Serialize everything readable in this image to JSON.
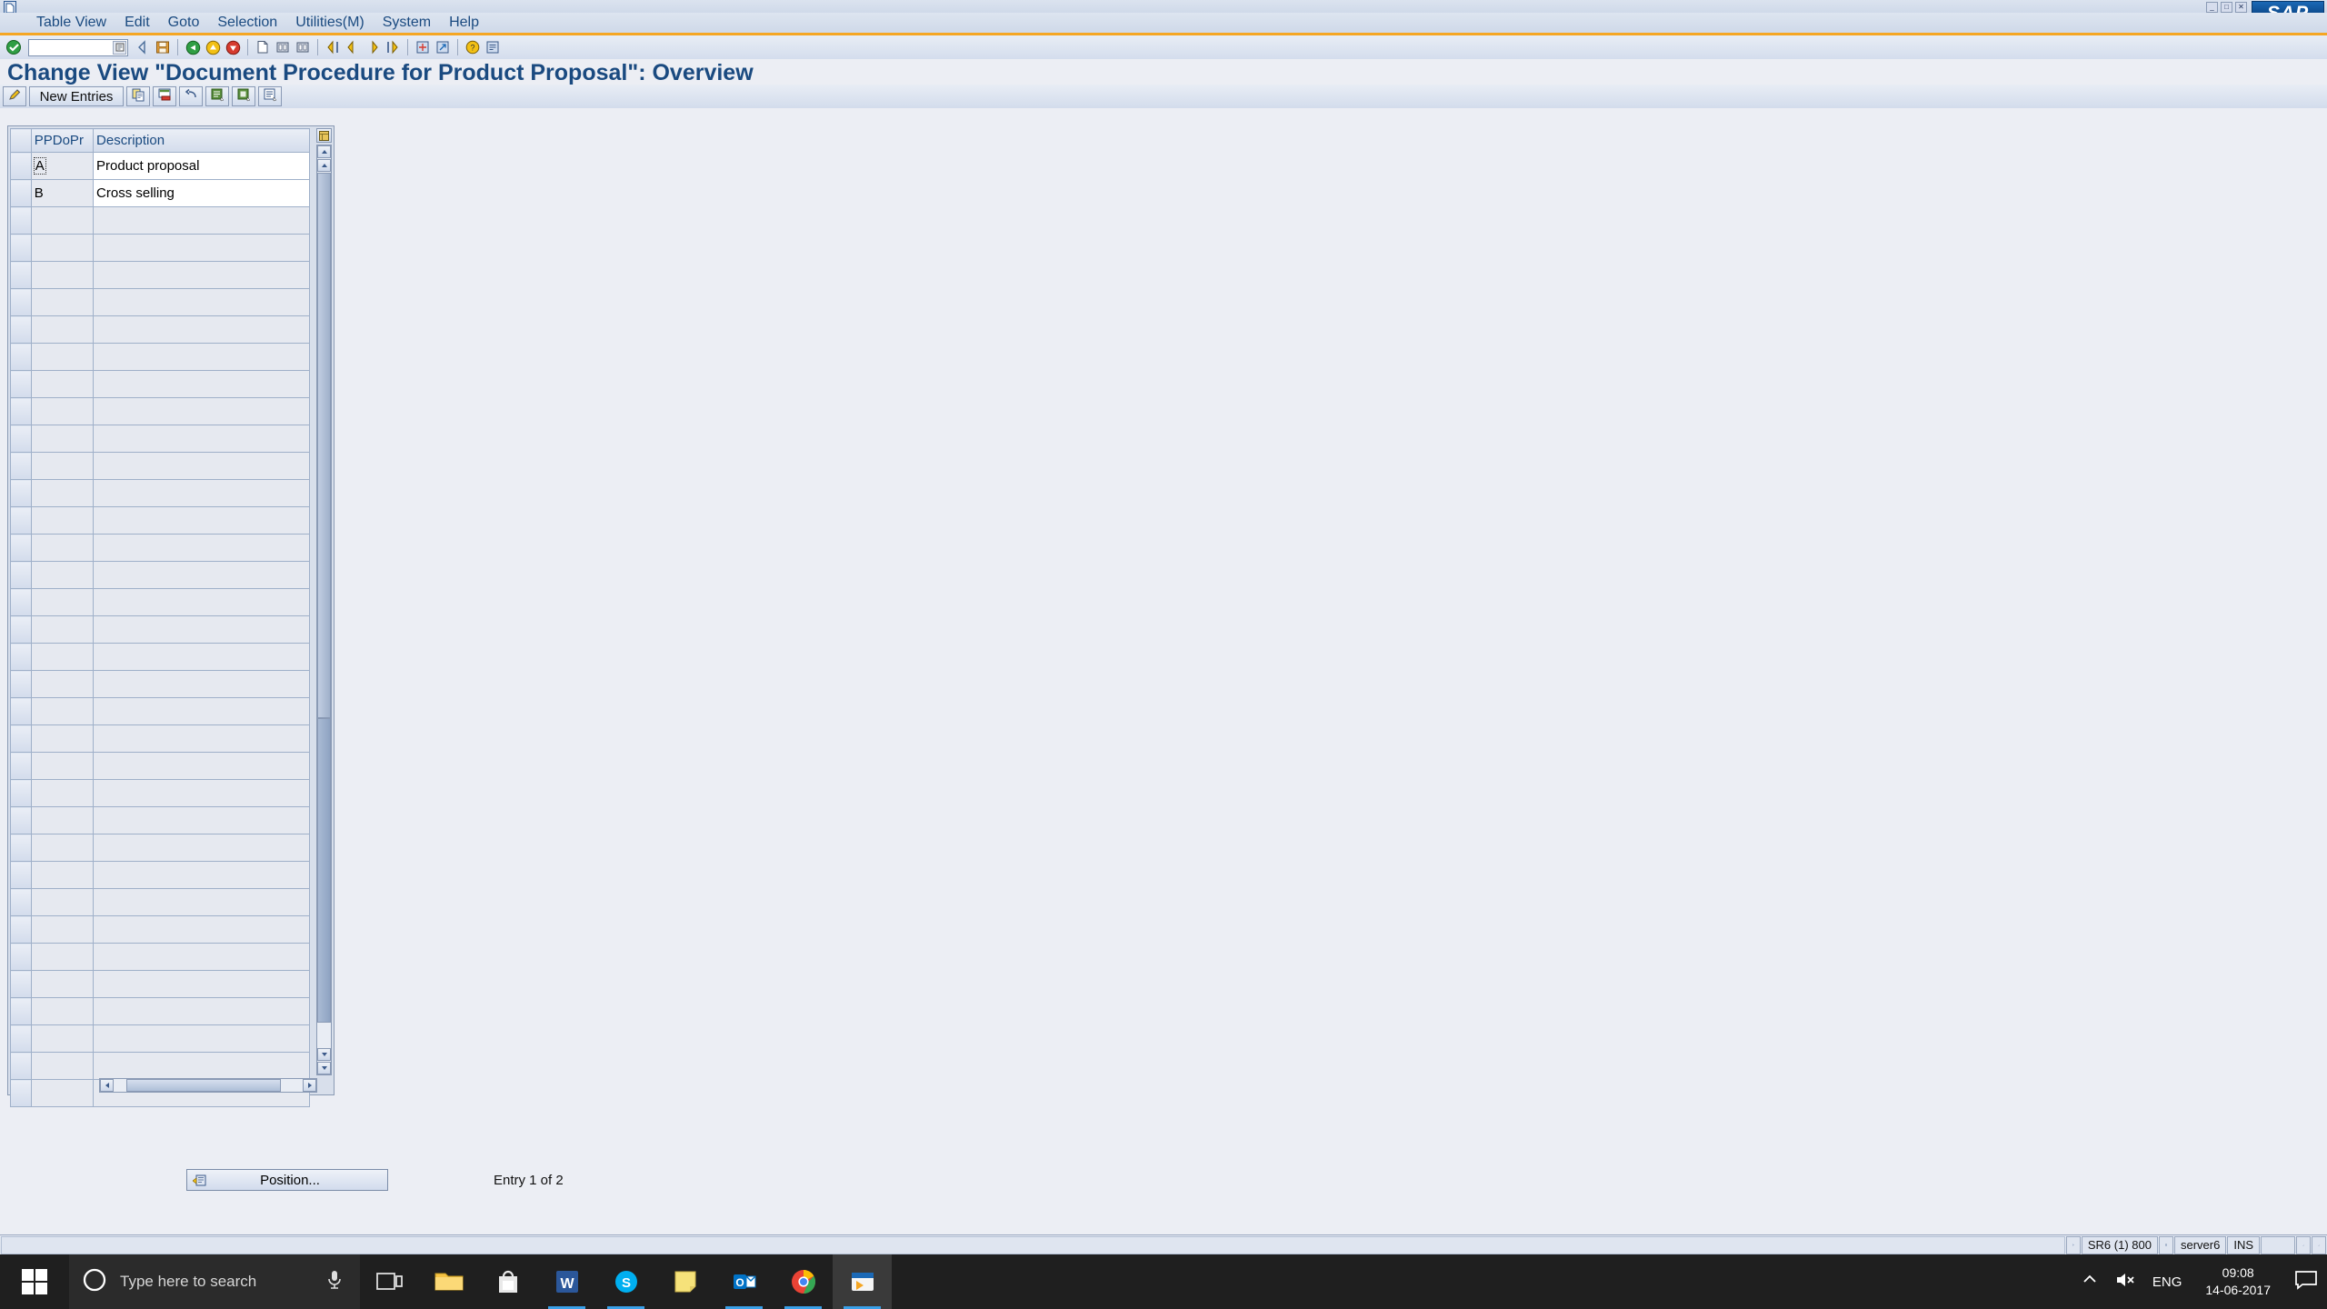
{
  "window": {
    "minimize": "_",
    "maximize": "□",
    "close": "✕",
    "logo": "SAP"
  },
  "menubar": {
    "items": [
      {
        "label": "Table View"
      },
      {
        "label": "Edit"
      },
      {
        "label": "Goto"
      },
      {
        "label": "Selection"
      },
      {
        "label": "Utilities(M)"
      },
      {
        "label": "System"
      },
      {
        "label": "Help"
      }
    ]
  },
  "command": {
    "value": "",
    "placeholder": ""
  },
  "page": {
    "title": "Change View \"Document Procedure for Product Proposal\": Overview"
  },
  "apptoolbar": {
    "new_entries": "New Entries",
    "buttons": [
      {
        "name": "display-change-icon"
      },
      {
        "name": "copy-as-icon"
      },
      {
        "name": "delete-icon"
      },
      {
        "name": "undo-icon"
      },
      {
        "name": "select-all-icon"
      },
      {
        "name": "deselect-all-icon"
      },
      {
        "name": "variable-list-icon"
      }
    ]
  },
  "table": {
    "columns": [
      "",
      "PPDoPr",
      "Description"
    ],
    "rows": [
      {
        "key": "A",
        "description": "Product proposal"
      },
      {
        "key": "B",
        "description": "Cross selling"
      }
    ],
    "empty_row_count": 33
  },
  "footer": {
    "position_label": "Position...",
    "entry_text": "Entry 1 of 2"
  },
  "statusbar": {
    "message": "",
    "system": "SR6 (1) 800",
    "server": "server6",
    "mode": "INS"
  },
  "taskbar": {
    "search_placeholder": "Type here to search",
    "language": "ENG",
    "time": "09:08",
    "date": "14-06-2017",
    "apps": [
      {
        "name": "file-explorer-icon"
      },
      {
        "name": "microsoft-store-icon"
      },
      {
        "name": "word-icon"
      },
      {
        "name": "skype-icon"
      },
      {
        "name": "sticky-notes-icon"
      },
      {
        "name": "outlook-icon"
      },
      {
        "name": "chrome-icon"
      },
      {
        "name": "sap-logon-icon"
      }
    ]
  },
  "colors": {
    "accent_orange": "#f5a623",
    "title_blue": "#1a4a80",
    "chrome_bg": "#eceef4",
    "taskbar_bg": "#1f1f1f"
  }
}
